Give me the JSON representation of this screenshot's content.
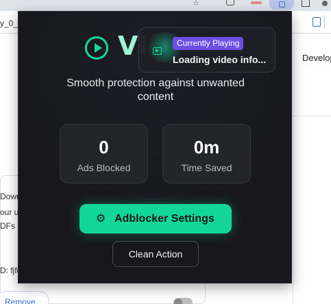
{
  "browser": {
    "bookmark_left": "y_0_",
    "page_right_text": "Develop"
  },
  "extension_card": {
    "line1": "Down",
    "line2": "our u",
    "line3": "DFs",
    "line4": "D: fjfc",
    "remove_label": "Remove"
  },
  "popup": {
    "brand_visible": "Vi",
    "subtitle": "Smooth protection against unwanted content",
    "stats": {
      "ads_blocked_value": "0",
      "ads_blocked_label": "Ads Blocked",
      "time_saved_value": "0m",
      "time_saved_label": "Time Saved"
    },
    "settings_button_label": "Adblocker Settings",
    "clean_button_label": "Clean Action",
    "now_playing": {
      "badge": "Currently Playing",
      "title": "Loading video info..."
    },
    "colors": {
      "accent": "#12d69a",
      "badge": "#6d4ee8",
      "background": "#17171d"
    }
  }
}
